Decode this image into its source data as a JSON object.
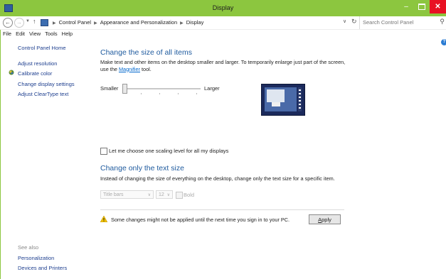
{
  "window": {
    "title": "Display",
    "accent_color": "#8cc63f",
    "close_color": "#e81123",
    "min_glyph": "–",
    "close_glyph": "✕"
  },
  "address": {
    "breadcrumb": [
      "Control Panel",
      "Appearance and Personalization",
      "Display"
    ],
    "search_placeholder": "Search Control Panel"
  },
  "menu": [
    "File",
    "Edit",
    "View",
    "Tools",
    "Help"
  ],
  "sidebar": {
    "home": "Control Panel Home",
    "links": [
      "Adjust resolution",
      "Calibrate color",
      "Change display settings",
      "Adjust ClearType text"
    ],
    "see_also_title": "See also",
    "see_also": [
      "Personalization",
      "Devices and Printers"
    ]
  },
  "main": {
    "size_heading": "Change the size of all items",
    "size_desc_1": "Make text and other items on the desktop smaller and larger. To temporarily enlarge just part of the screen,",
    "size_desc_2_prefix": "use the ",
    "magnifier_link": "Magnifier",
    "size_desc_2_suffix": " tool.",
    "slider_min_label": "Smaller",
    "slider_max_label": "Larger",
    "slider_value": 0,
    "scaling_checkbox_label": "Let me choose one scaling level for all my displays",
    "scaling_checked": false,
    "text_heading": "Change only the text size",
    "text_desc": "Instead of changing the size of everything on the desktop, change only the text size for a specific item.",
    "item_select": "Title bars",
    "font_size_select": "12",
    "bold_label": "Bold",
    "warning": "Some changes might not be applied until the next time you sign in to your PC.",
    "apply_prefix": "",
    "apply_mnemonic": "A",
    "apply_rest": "pply"
  }
}
